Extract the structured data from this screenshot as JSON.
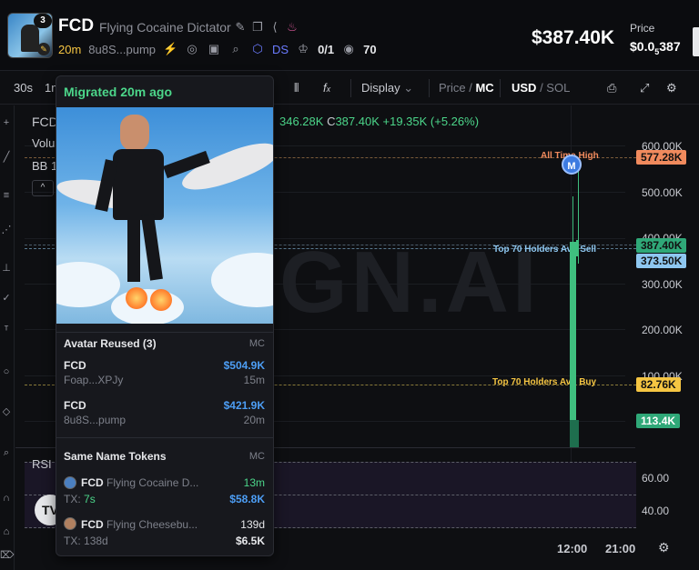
{
  "header": {
    "thumb_badge": "3",
    "symbol": "FCD",
    "name": "Flying Cocaine Dictator",
    "age": "20m",
    "address": "8u8S...pump",
    "ds_label": "DS",
    "holders": "0/1",
    "watchers": "70",
    "market_cap": "$387.40K",
    "price_label": "Price",
    "price_value_prefix": "$0.0",
    "price_value_sub": "5",
    "price_value_suffix": "387"
  },
  "toolbar": {
    "interval_30s": "30s",
    "interval_1m": "1m",
    "display": "Display",
    "price": "Price",
    "mc": "MC",
    "usd": "USD",
    "sol": "SOL"
  },
  "chart": {
    "title": "FCD",
    "volume_label": "Volu",
    "bb_label": "BB 1",
    "ohlc_prefix": "346.28K",
    "ohlc_close_label": "C",
    "ohlc_close": "387.40K",
    "ohlc_change": "+19.35K (+5.26%)",
    "watermark": "GN.AI",
    "axis": [
      "600.00K",
      "500.00K",
      "400.00K",
      "300.00K",
      "200.00K",
      "100.00K"
    ],
    "ath_label": "All Time High",
    "ath_value": "577.28K",
    "current_value": "387.40K",
    "avg_sell_label": "Top 70 Holders Avg Sell",
    "avg_sell_value": "373.50K",
    "avg_buy_label": "Top 70 Holders Avg Buy",
    "avg_buy_value": "82.76K",
    "volume_value": "113.4K",
    "marker": "M",
    "rsi_label": "RSI",
    "rsi_axis": [
      "60.00",
      "40.00"
    ],
    "time_labels": [
      "12:00",
      "21:00"
    ],
    "tv_logo": "TV"
  },
  "popup": {
    "title": "Migrated 20m ago",
    "avatar_section": "Avatar Reused (3)",
    "same_name_section": "Same Name Tokens",
    "mc_label": "MC",
    "avatar_rows": [
      {
        "name": "FCD",
        "addr": "Foap...XPJy",
        "value": "$504.9K",
        "time": "15m"
      },
      {
        "name": "FCD",
        "addr": "8u8S...pump",
        "value": "$421.9K",
        "time": "20m"
      }
    ],
    "same_name_rows": [
      {
        "symbol": "FCD",
        "name": "Flying Cocaine D...",
        "tx_label": "TX:",
        "tx": "7s",
        "age": "13m",
        "value": "$58.8K"
      },
      {
        "symbol": "FCD",
        "name": "Flying Cheesebu...",
        "tx_label": "TX:",
        "tx": "138d",
        "age": "139d",
        "value": "$6.5K"
      }
    ]
  },
  "colors": {
    "green": "#4cd68a",
    "blue_value": "#4d9ef5",
    "ath": "#f08a5d",
    "sell": "#8ec7f0",
    "buy": "#f5c542",
    "volume": "#2fa878"
  }
}
